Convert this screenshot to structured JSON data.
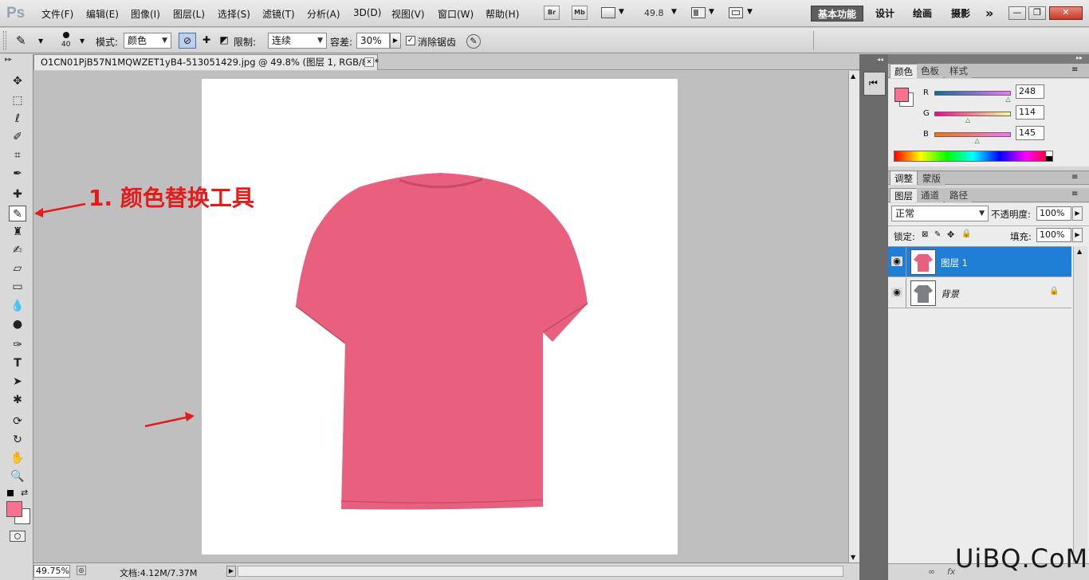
{
  "app": {
    "logo": "Ps"
  },
  "menu": [
    "文件(F)",
    "编辑(E)",
    "图像(I)",
    "图层(L)",
    "选择(S)",
    "滤镜(T)",
    "分析(A)",
    "3D(D)",
    "视图(V)",
    "窗口(W)",
    "帮助(H)"
  ],
  "menu_icons": {
    "br": "Br",
    "mb": "Mb"
  },
  "zoom_display": "49.8",
  "workspaces": [
    "基本功能",
    "设计",
    "绘画",
    "摄影"
  ],
  "workspace_more": "»",
  "window_controls": [
    "—",
    "❐",
    "✕"
  ],
  "options": {
    "brush_size": "40",
    "mode_label": "模式:",
    "mode_value": "颜色",
    "limit_label": "限制:",
    "limit_value": "连续",
    "tolerance_label": "容差:",
    "tolerance_value": "30%",
    "antialias_label": "消除锯齿"
  },
  "document": {
    "tab_title": "O1CN01PjB57N1MQWZET1yB4-513051429.jpg @ 49.8% (图层 1, RGB/8) *",
    "close": "✕"
  },
  "status": {
    "zoom": "49.75%",
    "doc_info": "文档:4.12M/7.37M"
  },
  "color_panel": {
    "tabs": [
      "颜色",
      "色板",
      "样式"
    ],
    "foreground": "#f8728f",
    "r_label": "R",
    "r_value": "248",
    "r": 248,
    "g_label": "G",
    "g_value": "114",
    "g": 114,
    "b_label": "B",
    "b_value": "145",
    "b": 145
  },
  "adjust_panel": {
    "tabs": [
      "调整",
      "蒙版"
    ]
  },
  "layers_panel": {
    "tabs": [
      "图层",
      "通道",
      "路径"
    ],
    "blend_mode": "正常",
    "opacity_label": "不透明度:",
    "opacity_value": "100%",
    "lock_label": "锁定:",
    "fill_label": "填充:",
    "fill_value": "100%",
    "layers": [
      {
        "name": "图层 1",
        "selected": true,
        "thumb_color": "#e8607e"
      },
      {
        "name": "背景",
        "selected": false,
        "thumb_color": "#7d7f86"
      }
    ]
  },
  "annotation": {
    "text": "1. 颜色替换工具",
    "color": "#e31b1b"
  },
  "shirt": {
    "color": "#e8607e"
  },
  "watermark": "UiBQ.CoM"
}
